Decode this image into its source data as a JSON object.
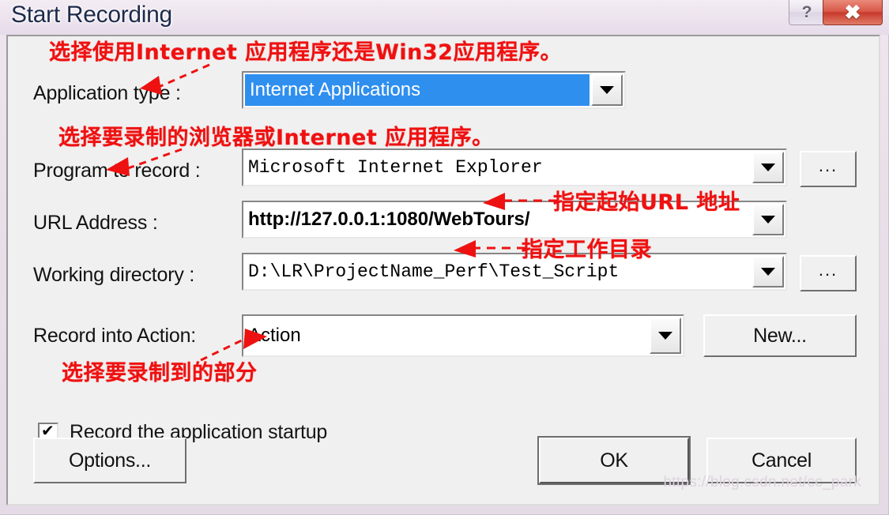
{
  "window": {
    "title": "Start Recording",
    "help_glyph": "?",
    "close_glyph": "✖"
  },
  "form": {
    "rows": [
      {
        "label": "Application type :",
        "value": "Internet Applications",
        "highlighted": true,
        "has_browse": false
      },
      {
        "label": "Program to record :",
        "value": "Microsoft Internet Explorer",
        "highlighted": false,
        "has_browse": true,
        "browse_label": "..."
      },
      {
        "label": "URL Address :",
        "value": "http://127.0.0.1:1080/WebTours/",
        "highlighted": false,
        "has_browse": false
      },
      {
        "label": "Working directory :",
        "value": "D:\\LR\\ProjectName_Perf\\Test_Script",
        "highlighted": false,
        "has_browse": true,
        "browse_label": "..."
      },
      {
        "label": "Record into Action:",
        "value": "Action",
        "highlighted": false,
        "has_browse": false,
        "side_button": "New..."
      }
    ],
    "checkbox": {
      "label": "Record the application startup",
      "checked": true
    }
  },
  "buttons": {
    "options": "Options...",
    "ok": "OK",
    "cancel": "Cancel",
    "new": "New...",
    "browse": "..."
  },
  "annotations": [
    {
      "text": "选择使用Internet 应用程序还是Win32应用程序。"
    },
    {
      "text": "选择要录制的浏览器或Internet 应用程序。"
    },
    {
      "text": "指定起始URL 地址"
    },
    {
      "text": "指定工作目录"
    },
    {
      "text": "选择要录制到的部分"
    }
  ],
  "watermark": "https://blog.csdn.net/cc_park",
  "colors": {
    "annotation_red": "#ee1111",
    "selection_blue": "#2f8fef",
    "close_red": "#c8392c",
    "client_bg": "#f0f0f0"
  }
}
